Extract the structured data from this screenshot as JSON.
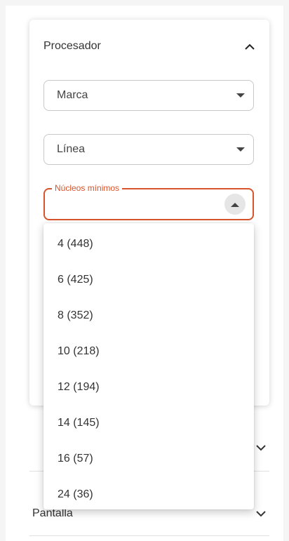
{
  "filter_panel": {
    "title": "Procesador",
    "brand_select": {
      "value": "Marca"
    },
    "line_select": {
      "value": "Línea"
    },
    "cores_select": {
      "label": "Núcleos mínimos",
      "value": ""
    }
  },
  "cores_options": [
    "4 (448)",
    "6 (425)",
    "8 (352)",
    "10 (218)",
    "12 (194)",
    "14 (145)",
    "16 (57)",
    "24 (36)"
  ],
  "lower_sections": [
    {
      "label": ""
    },
    {
      "label": "Pantalla"
    }
  ],
  "colors": {
    "accent": "#d9532b",
    "border": "#c8c8c8",
    "text": "#333333"
  },
  "icons": {
    "collapse": "chevron-up-icon",
    "dropdown": "caret-down-icon",
    "expand": "chevron-down-icon"
  }
}
